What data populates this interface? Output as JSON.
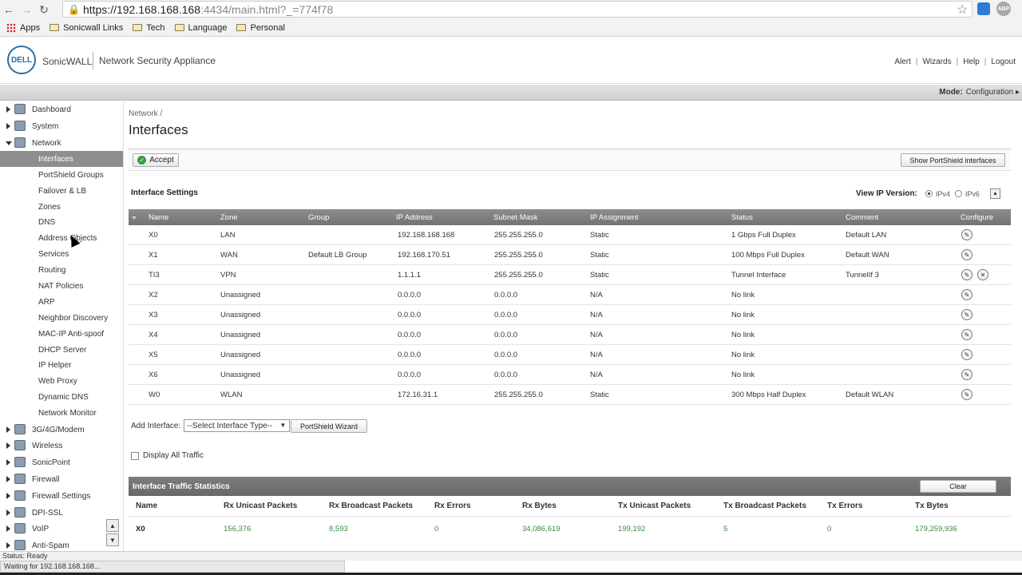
{
  "browser": {
    "url_scheme_host": "https://192.168.168.168",
    "url_rest": ":4434/main.html?_=774f78",
    "ext_badge": "ABP",
    "bookmarks": [
      "Apps",
      "Sonicwall Links",
      "Tech",
      "Language",
      "Personal"
    ]
  },
  "header": {
    "logo_text": "DELL",
    "brand": "SonicWALL",
    "product": "Network Security Appliance",
    "links": [
      "Alert",
      "Wizards",
      "Help",
      "Logout"
    ]
  },
  "mode": {
    "label": "Mode:",
    "value": "Configuration"
  },
  "sidebar": {
    "groups_top": [
      {
        "label": "Dashboard"
      },
      {
        "label": "System"
      },
      {
        "label": "Network"
      }
    ],
    "network_items": [
      "Interfaces",
      "PortShield Groups",
      "Failover & LB",
      "Zones",
      "DNS",
      "Address Objects",
      "Services",
      "Routing",
      "NAT Policies",
      "ARP",
      "Neighbor Discovery",
      "MAC-IP Anti-spoof",
      "DHCP Server",
      "IP Helper",
      "Web Proxy",
      "Dynamic DNS",
      "Network Monitor"
    ],
    "groups_bottom": [
      "3G/4G/Modem",
      "Wireless",
      "SonicPoint",
      "Firewall",
      "Firewall Settings",
      "DPI-SSL",
      "VoIP",
      "Anti-Spam"
    ],
    "active_item": "Interfaces"
  },
  "main": {
    "breadcrumb": "Network /",
    "title": "Interfaces",
    "accept_label": "Accept",
    "portshield_label": "Show PortShield interfaces",
    "settings_title": "Interface Settings",
    "ip_version_label": "View IP Version:",
    "ipv4_label": "IPv4",
    "ipv6_label": "IPv6",
    "selected_ip_version": "IPv4",
    "table": {
      "headers": [
        "Name",
        "Zone",
        "Group",
        "IP Address",
        "Subnet Mask",
        "IP Assignment",
        "Status",
        "Comment",
        "Configure"
      ],
      "rows": [
        [
          "X0",
          "LAN",
          "",
          "192.168.168.168",
          "255.255.255.0",
          "Static",
          "1 Gbps Full Duplex",
          "Default LAN"
        ],
        [
          "X1",
          "WAN",
          "Default LB Group",
          "192.168.170.51",
          "255.255.255.0",
          "Static",
          "100 Mbps Full Duplex",
          "Default WAN"
        ],
        [
          "TI3",
          "VPN",
          "",
          "1.1.1.1",
          "255.255.255.0",
          "Static",
          "Tunnel Interface",
          "TunnelIf 3"
        ],
        [
          "X2",
          "Unassigned",
          "",
          "0.0.0.0",
          "0.0.0.0",
          "N/A",
          "No link",
          ""
        ],
        [
          "X3",
          "Unassigned",
          "",
          "0.0.0.0",
          "0.0.0.0",
          "N/A",
          "No link",
          ""
        ],
        [
          "X4",
          "Unassigned",
          "",
          "0.0.0.0",
          "0.0.0.0",
          "N/A",
          "No link",
          ""
        ],
        [
          "X5",
          "Unassigned",
          "",
          "0.0.0.0",
          "0.0.0.0",
          "N/A",
          "No link",
          ""
        ],
        [
          "X6",
          "Unassigned",
          "",
          "0.0.0.0",
          "0.0.0.0",
          "N/A",
          "No link",
          ""
        ],
        [
          "W0",
          "WLAN",
          "",
          "172.16.31.1",
          "255.255.255.0",
          "Static",
          "300 Mbps Half Duplex",
          "Default WLAN"
        ]
      ]
    },
    "add_interface_label": "Add Interface:",
    "add_interface_select": "--Select Interface Type--",
    "wizard_label": "PortShield Wizard",
    "display_all_label": "Display All Traffic",
    "stats": {
      "title": "Interface Traffic Statistics",
      "clear_label": "Clear",
      "headers": [
        "Name",
        "Rx Unicast Packets",
        "Rx Broadcast Packets",
        "Rx Errors",
        "Rx Bytes",
        "Tx Unicast Packets",
        "Tx Broadcast Packets",
        "Tx Errors",
        "Tx Bytes"
      ],
      "rows": [
        [
          "X0",
          "156,376",
          "8,593",
          "0",
          "34,086,619",
          "199,192",
          "5",
          "0",
          "179,259,936"
        ]
      ]
    }
  },
  "status": {
    "text": "Status: Ready",
    "loading": "Waiting for 192.168.168.168..."
  },
  "colors": {
    "header_bg": "#7a7a7a",
    "active_item_bg": "#8e8e8e",
    "stat_value": "#3a8a3a",
    "accent_blue": "#2e6da4"
  }
}
